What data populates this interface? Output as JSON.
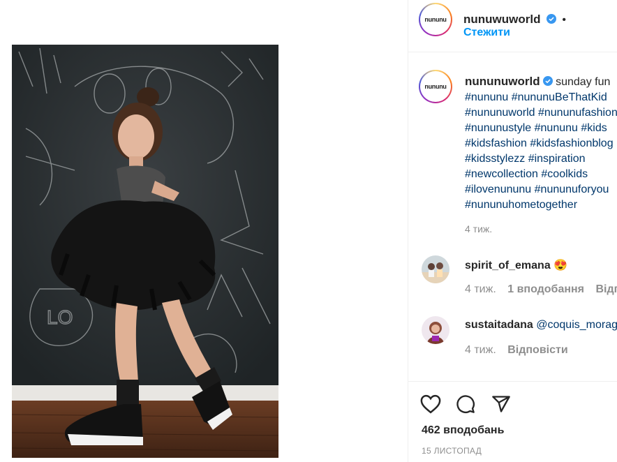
{
  "header": {
    "username": "nunuwuworld",
    "follow_label": "Стежити",
    "avatar_logo_text": "nununu"
  },
  "caption": {
    "username": "nununuworld",
    "lines": [
      "sunday fun",
      "#nununu #nununuBeThatKid",
      "#nununuworld #nununufashion",
      "#nununustyle #nununu #kids",
      "#kidsfashion #kidsfashionblog",
      "#kidsstylezz #inspiration",
      "#newcollection #coolkids",
      "#ilovenununu #nununuforyou",
      "#nununuhometogether"
    ],
    "time": "4 тиж."
  },
  "comments": [
    {
      "username": "spirit_of_emana",
      "text": "😍",
      "time": "4 тиж.",
      "likes": "1 вподобання",
      "reply": "Відповісти"
    },
    {
      "username": "sustaitadana",
      "text": "@coquis_moraga",
      "time": "4 тиж.",
      "reply": "Відповісти"
    }
  ],
  "footer": {
    "likes": "462 вподобань",
    "date": "15 ЛИСТОПАД"
  },
  "icons": [
    "heart-icon",
    "comment-icon",
    "share-icon",
    "verified-badge-icon"
  ],
  "colors": {
    "link": "#0095f6",
    "hashtag": "#00376b",
    "muted": "#8e8e8e"
  }
}
